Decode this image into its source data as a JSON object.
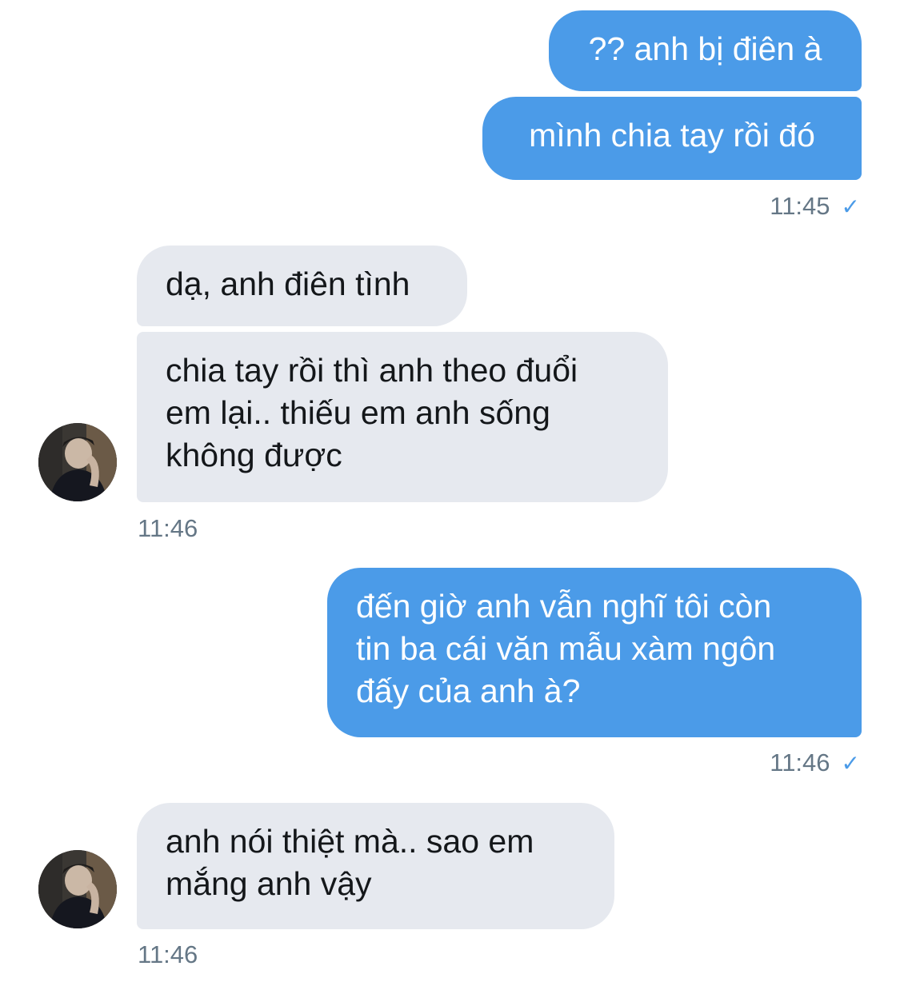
{
  "messages": [
    {
      "text": "?? anh bị điên à"
    },
    {
      "text": "mình chia tay rồi đó"
    },
    {
      "text": "dạ, anh điên tình"
    },
    {
      "text": "chia tay rồi thì anh theo đuổi\nem lại.. thiếu em anh sống\nkhông được"
    },
    {
      "text": "đến giờ anh vẫn nghĩ tôi còn\ntin ba cái văn mẫu xàm ngôn\nđấy của anh à?"
    },
    {
      "text": "anh nói thiệt mà.. sao em\nmắng anh vậy"
    }
  ],
  "timestamps": {
    "t1": "11:45",
    "t2": "11:46",
    "t3": "11:46",
    "t4": "11:46"
  },
  "icons": {
    "sent_check": "check-icon",
    "avatar": "avatar"
  },
  "colors": {
    "outgoing": "#4b9be8",
    "incoming": "#e6e9ef",
    "timestamp": "#657786"
  }
}
